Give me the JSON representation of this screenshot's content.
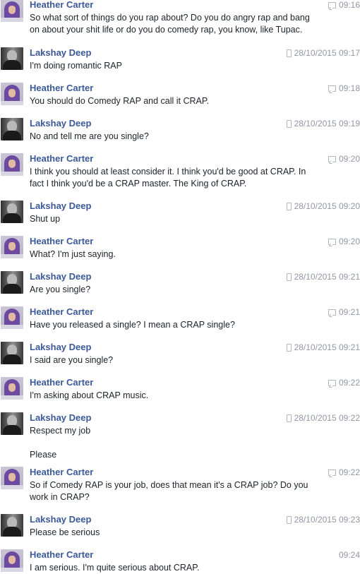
{
  "messages": [
    {
      "sender": "Heather Carter",
      "time": "09:16",
      "icon": "chat-icon",
      "lines": [
        "So what sort of things do you rap about? Do you do angry rap and bang",
        "on about your shit life or do you do comedy rap, you know, like Tupac."
      ]
    },
    {
      "sender": "Lakshay Deep",
      "time": "28/10/2015 09:17",
      "icon": "mobile-phone-icon",
      "lines": [
        "I'm doing romantic RAP"
      ]
    },
    {
      "sender": "Heather Carter",
      "time": "09:18",
      "icon": "chat-icon",
      "lines": [
        "You should do Comedy RAP and call it CRAP."
      ]
    },
    {
      "sender": "Lakshay Deep",
      "time": "28/10/2015 09:19",
      "icon": "mobile-phone-icon",
      "lines": [
        "No and tell me are you single?"
      ]
    },
    {
      "sender": "Heather Carter",
      "time": "09:20",
      "icon": "chat-icon",
      "lines": [
        "I think you should at least consider it. I think you'd be good at CRAP. In",
        "fact I think you'd be a CRAP master. The King of CRAP."
      ]
    },
    {
      "sender": "Lakshay Deep",
      "time": "28/10/2015 09:20",
      "icon": "mobile-phone-icon",
      "lines": [
        "Shut up"
      ]
    },
    {
      "sender": "Heather Carter",
      "time": "09:20",
      "icon": "chat-icon",
      "lines": [
        "What? I'm just saying."
      ]
    },
    {
      "sender": "Lakshay Deep",
      "time": "28/10/2015 09:21",
      "icon": "mobile-phone-icon",
      "lines": [
        "Are you single?"
      ]
    },
    {
      "sender": "Heather Carter",
      "time": "09:21",
      "icon": "chat-icon",
      "lines": [
        "Have you released a single? I mean a CRAP single?"
      ]
    },
    {
      "sender": "Lakshay Deep",
      "time": "28/10/2015 09:21",
      "icon": "mobile-phone-icon",
      "lines": [
        "I said are you single?"
      ]
    },
    {
      "sender": "Heather Carter",
      "time": "09:22",
      "icon": "chat-icon",
      "lines": [
        "I'm asking about CRAP music."
      ]
    },
    {
      "sender": "Lakshay Deep",
      "time": "28/10/2015 09:22",
      "icon": "mobile-phone-icon",
      "lines": [
        "Respect my job",
        "",
        "Please"
      ]
    },
    {
      "sender": "Heather Carter",
      "time": "09:22",
      "icon": "chat-icon",
      "lines": [
        "So if Comedy RAP is your job, does that mean it's a CRAP job? Do you",
        "work in CRAP?"
      ]
    },
    {
      "sender": "Lakshay Deep",
      "time": "28/10/2015 09:23",
      "icon": "mobile-phone-icon",
      "lines": [
        "Please be serious"
      ]
    },
    {
      "sender": "Heather Carter",
      "time": "09:24",
      "icon": "",
      "lines": [
        "I am serious. I'm quite serious about CRAP."
      ]
    }
  ]
}
